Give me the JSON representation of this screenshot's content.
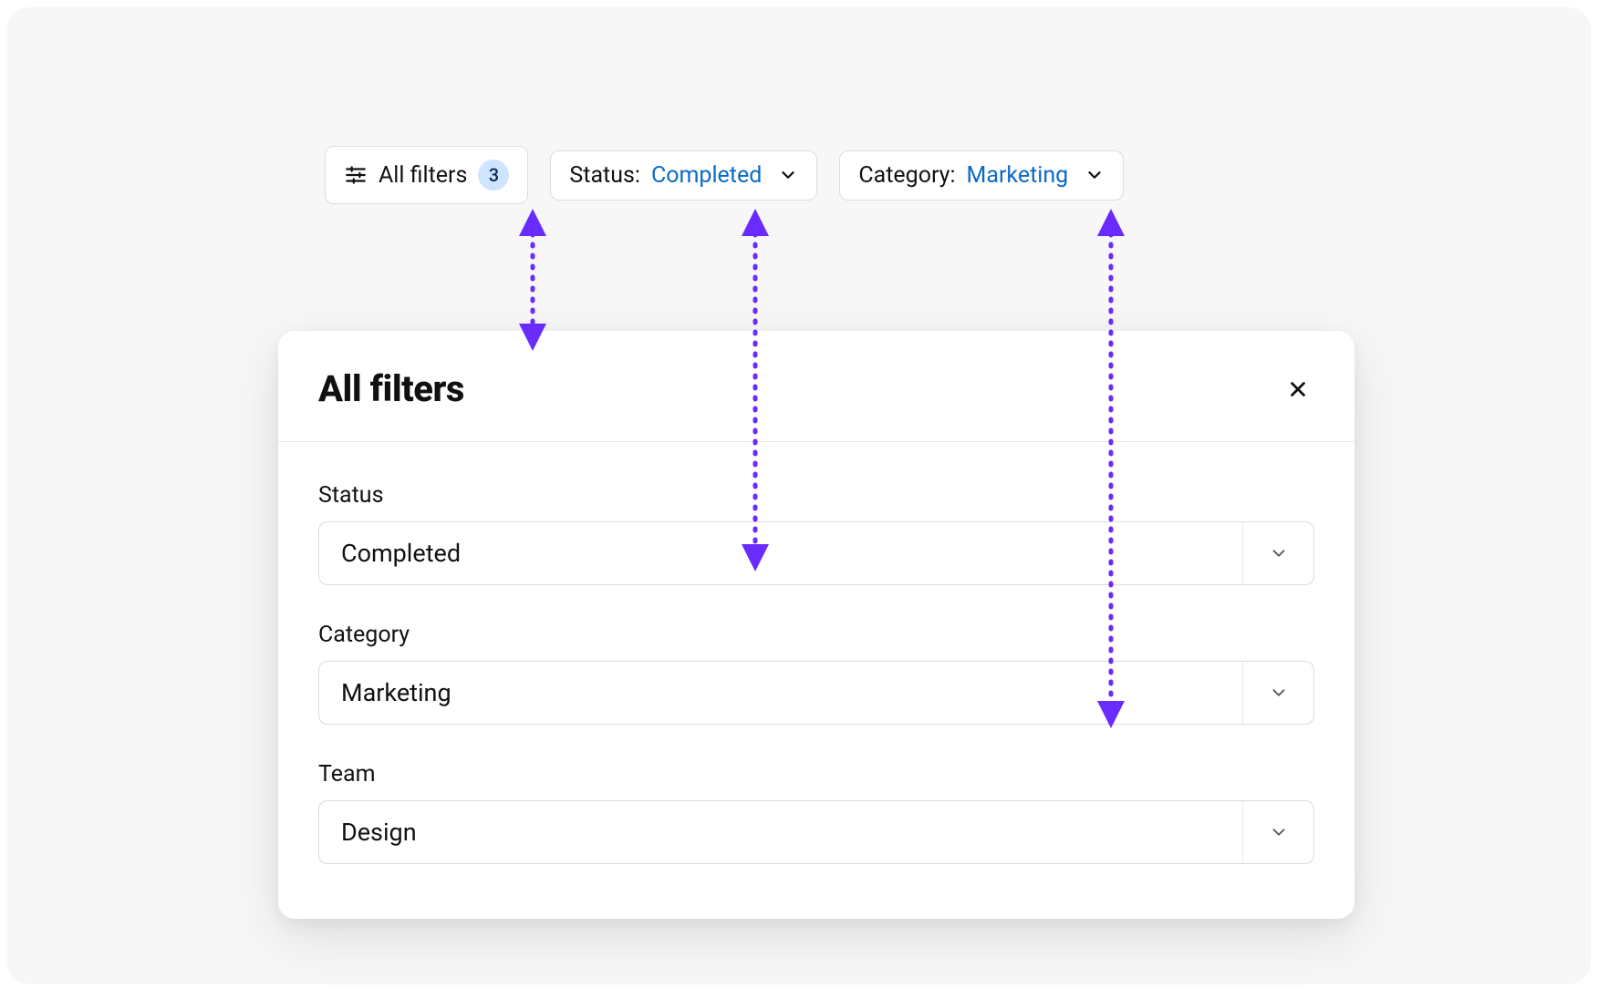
{
  "colors": {
    "link_blue": "#0b69c7",
    "badge_bg": "#cfe4ff",
    "accent_purple": "#6a2bff"
  },
  "chips": {
    "all_filters": {
      "label": "All filters",
      "count": "3"
    },
    "status": {
      "label": "Status:",
      "value": "Completed"
    },
    "category": {
      "label": "Category:",
      "value": "Marketing"
    }
  },
  "panel": {
    "title": "All filters",
    "fields": [
      {
        "label": "Status",
        "value": "Completed"
      },
      {
        "label": "Category",
        "value": "Marketing"
      },
      {
        "label": "Team",
        "value": "Design"
      }
    ]
  }
}
